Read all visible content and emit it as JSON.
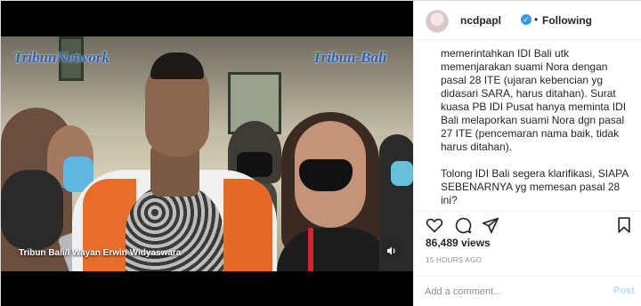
{
  "video": {
    "watermark_left": "TribunNetwork",
    "watermark_right": "Tribun-Bali",
    "caption": "Tribun Bali/I Wayan Erwin Widyaswara",
    "sound_icon": "speaker-icon"
  },
  "header": {
    "username": "ncdpapl",
    "separator": "•",
    "follow_state": "Following"
  },
  "comment": {
    "paragraphs": [
      "memerintahkan IDI Bali utk memenjarakan suami Nora dengan pasal 28 ITE (ujaran kebencian yg didasari SARA, harus ditahan). Surat kuasa PB IDI Pusat hanya meminta IDI Bali melaporkan suami Nora dgn pasal 27 ITE (pencemaran nama baik, tidak harus ditahan).",
      "Tolong IDI Bali segera klarifikasi, SIAPA SEBENARNYA yg memesan pasal 28 ini?"
    ]
  },
  "stats": {
    "views": "86,489 views",
    "time": "15 HOURS AGO"
  },
  "add_comment": {
    "placeholder": "Add a comment...",
    "post_label": "Post"
  },
  "colors": {
    "link_blue": "#3897f0",
    "post_disabled": "#b2dffc",
    "border": "#efefef",
    "muted": "#8e8e8e"
  }
}
